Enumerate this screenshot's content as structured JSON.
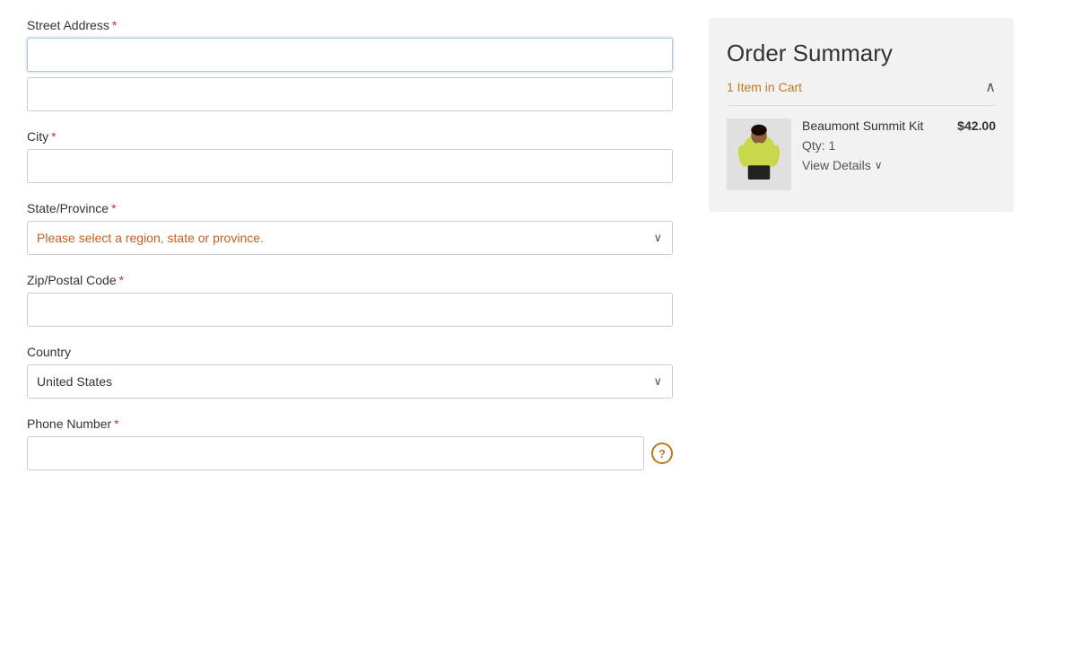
{
  "form": {
    "street_address_label": "Street Address",
    "street_address_line1_placeholder": "",
    "street_address_line2_placeholder": "",
    "city_label": "City",
    "city_placeholder": "",
    "state_province_label": "State/Province",
    "state_province_placeholder": "Please select a region, state or province.",
    "zip_postal_label": "Zip/Postal Code",
    "zip_postal_placeholder": "",
    "country_label": "Country",
    "country_value": "United States",
    "phone_label": "Phone Number",
    "phone_placeholder": "",
    "required_star": "*",
    "help_icon_label": "?"
  },
  "order_summary": {
    "title": "Order Summary",
    "items_in_cart": "1 Item in Cart",
    "collapse_icon": "∧",
    "item": {
      "name": "Beaumont Summit Kit",
      "price": "$42.00",
      "qty_label": "Qty: 1",
      "view_details_label": "View Details"
    }
  },
  "colors": {
    "required_red": "#c0392b",
    "accent_orange": "#c07820",
    "input_focus_blue": "#aac4e0",
    "summary_bg": "#f2f2f2"
  }
}
